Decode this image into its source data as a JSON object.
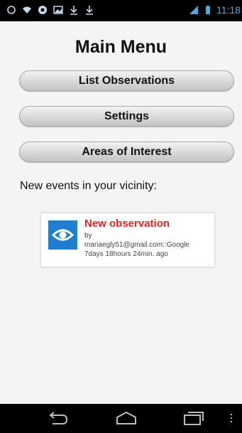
{
  "status_bar": {
    "time": "11:18",
    "icons": [
      "circle-icon",
      "wifi-icon",
      "location-icon",
      "image-icon",
      "download-icon",
      "download-icon",
      "signal-icon",
      "battery-icon"
    ]
  },
  "main": {
    "title": "Main Menu",
    "buttons": [
      {
        "label": "List Observations"
      },
      {
        "label": "Settings"
      },
      {
        "label": "Areas of Interest"
      }
    ],
    "vicinity_label": "New events in your vicinity:",
    "event": {
      "title": "New observation",
      "by": "by",
      "author": "mariaegly51@gmail.com::Google",
      "age": "7days 18hours 24min. ago",
      "icon": "eye-icon"
    }
  },
  "nav_bar": {
    "icons": [
      "back-icon",
      "home-icon",
      "recent-apps-icon",
      "menu-icon"
    ]
  },
  "colors": {
    "accent": "#1e7fd0",
    "event_title": "#e8221f",
    "status_time": "#4fa8e0"
  }
}
